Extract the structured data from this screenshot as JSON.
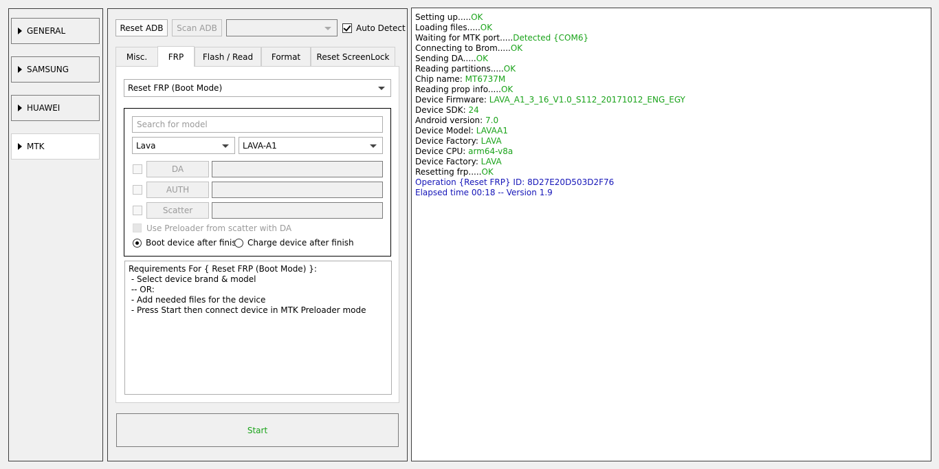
{
  "sidebar": {
    "items": [
      {
        "label": "GENERAL",
        "active": false
      },
      {
        "label": "SAMSUNG",
        "active": false
      },
      {
        "label": "HUAWEI",
        "active": false
      },
      {
        "label": "MTK",
        "active": true
      }
    ]
  },
  "toolbar": {
    "reset_adb": "Reset ADB",
    "scan_adb": "Scan ADB",
    "device_select_value": "",
    "auto_detect_label": "Auto Detect",
    "auto_detect_checked": true
  },
  "tabs": [
    {
      "label": "Misc.",
      "active": false
    },
    {
      "label": "FRP",
      "active": true
    },
    {
      "label": "Flash / Read",
      "active": false
    },
    {
      "label": "Format",
      "active": false
    },
    {
      "label": "Reset ScreenLock",
      "active": false
    }
  ],
  "frp": {
    "operation_select": "Reset FRP (Boot Mode)",
    "search_placeholder": "Search for model",
    "brand_select": "Lava",
    "model_select": "LAVA-A1",
    "da_button": "DA",
    "auth_button": "AUTH",
    "scatter_button": "Scatter",
    "use_preloader_label": "Use Preloader from scatter with DA",
    "boot_after_label": "Boot device after finish",
    "charge_after_label": "Charge device after finish",
    "requirements": [
      "Requirements For { Reset FRP (Boot Mode) }:",
      " - Select device brand & model",
      " -- OR:",
      " - Add needed files for the device",
      " - Press Start then connect device in MTK Preloader mode"
    ],
    "start_button": "Start"
  },
  "log": {
    "lines": [
      {
        "label": "Setting up.....",
        "value": "OK",
        "color": "ok"
      },
      {
        "label": "Loading files.....",
        "value": "OK",
        "color": "ok"
      },
      {
        "label": "Waiting for MTK port.....",
        "value": "Detected {COM6}",
        "color": "ok"
      },
      {
        "label": "Connecting to Brom.....",
        "value": "OK",
        "color": "ok"
      },
      {
        "label": "Sending DA.....",
        "value": "OK",
        "color": "ok"
      },
      {
        "label": "Reading partitions.....",
        "value": "OK",
        "color": "ok"
      },
      {
        "label": "Chip name: ",
        "value": "MT6737M",
        "color": "ok"
      },
      {
        "label": "Reading prop info.....",
        "value": "OK",
        "color": "ok"
      },
      {
        "label": "Device Firmware: ",
        "value": "LAVA_A1_3_16_V1.0_S112_20171012_ENG_EGY",
        "color": "ok"
      },
      {
        "label": "Device SDK: ",
        "value": "24",
        "color": "ok"
      },
      {
        "label": "Android version: ",
        "value": "7.0",
        "color": "ok"
      },
      {
        "label": "Device Model: ",
        "value": "LAVAA1",
        "color": "ok"
      },
      {
        "label": "Device Factory: ",
        "value": "LAVA",
        "color": "ok"
      },
      {
        "label": "Device CPU: ",
        "value": "arm64-v8a",
        "color": "ok"
      },
      {
        "label": "Device Factory: ",
        "value": "LAVA",
        "color": "ok"
      },
      {
        "label": "Resetting frp.....",
        "value": "OK",
        "color": "ok"
      },
      {
        "label": "Operation {Reset FRP} ID: 8D27E20D503D2F76",
        "value": "",
        "color": "blue"
      },
      {
        "label": "Elapsed time 00:18 -- Version 1.9",
        "value": "",
        "color": "blue"
      }
    ]
  },
  "colors": {
    "ok": "#1aa31a",
    "info": "#1414b8",
    "background": "#f0f0f0"
  }
}
